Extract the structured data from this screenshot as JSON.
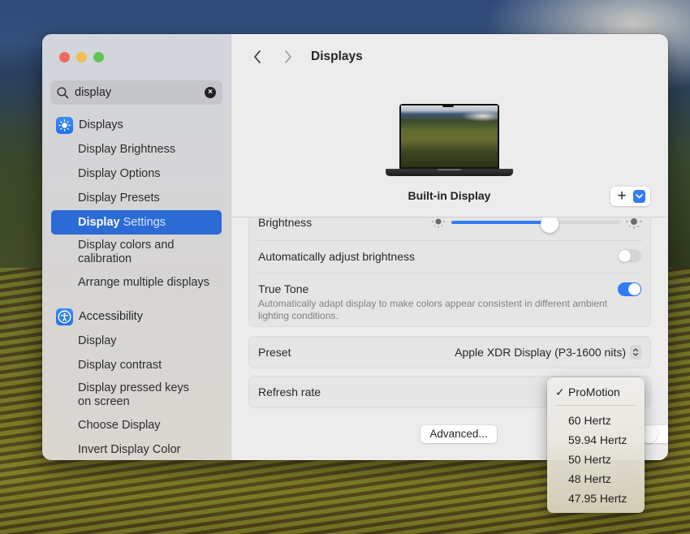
{
  "window": {
    "traffic_lights": [
      "close",
      "minimize",
      "maximize"
    ]
  },
  "sidebar": {
    "search": {
      "value": "display",
      "placeholder": "Search",
      "clear_icon": "clear-circle-icon"
    },
    "groups": [
      {
        "label": "Displays",
        "icon": "sun-brightness-icon",
        "items": [
          {
            "label": "Display Brightness"
          },
          {
            "label": "Display Options"
          },
          {
            "label": "Display Presets"
          },
          {
            "label_prefix": "Display",
            "label_suffix": " Settings",
            "selected": true
          },
          {
            "label": "Display colors and calibration"
          },
          {
            "label": "Arrange multiple displays"
          }
        ]
      },
      {
        "label": "Accessibility",
        "icon": "accessibility-person-icon",
        "items": [
          {
            "label": "Display"
          },
          {
            "label": "Display contrast"
          },
          {
            "label": "Display pressed keys on screen"
          },
          {
            "label": "Choose Display"
          },
          {
            "label": "Invert Display Color"
          }
        ]
      }
    ]
  },
  "header": {
    "back_icon": "chevron-left-icon",
    "forward_icon": "chevron-right-icon",
    "title": "Displays"
  },
  "display_preview": {
    "name": "Built-in Display",
    "add_label": "+",
    "add_menu_icon": "chevron-down-icon"
  },
  "settings": {
    "brightness": {
      "label": "Brightness",
      "value_percent": 58
    },
    "auto_brightness": {
      "label": "Automatically adjust brightness",
      "enabled": false
    },
    "true_tone": {
      "label": "True Tone",
      "description": "Automatically adapt display to make colors appear consistent in different ambient lighting conditions.",
      "enabled": true
    },
    "preset": {
      "label": "Preset",
      "value": "Apple XDR Display (P3-1600 nits)"
    },
    "refresh_rate": {
      "label": "Refresh rate",
      "value": "ProMotion"
    }
  },
  "footer": {
    "advanced_label": "Advanced..."
  },
  "refresh_menu": {
    "check_glyph": "✓",
    "selected": "ProMotion",
    "options": [
      "60 Hertz",
      "59.94 Hertz",
      "50 Hertz",
      "48 Hertz",
      "47.95 Hertz"
    ]
  },
  "colors": {
    "accent": "#2f7cf6",
    "selection": "#2c6bd6",
    "close": "#ec6a5e",
    "minimize": "#f4be4f",
    "maximize": "#61c554"
  }
}
